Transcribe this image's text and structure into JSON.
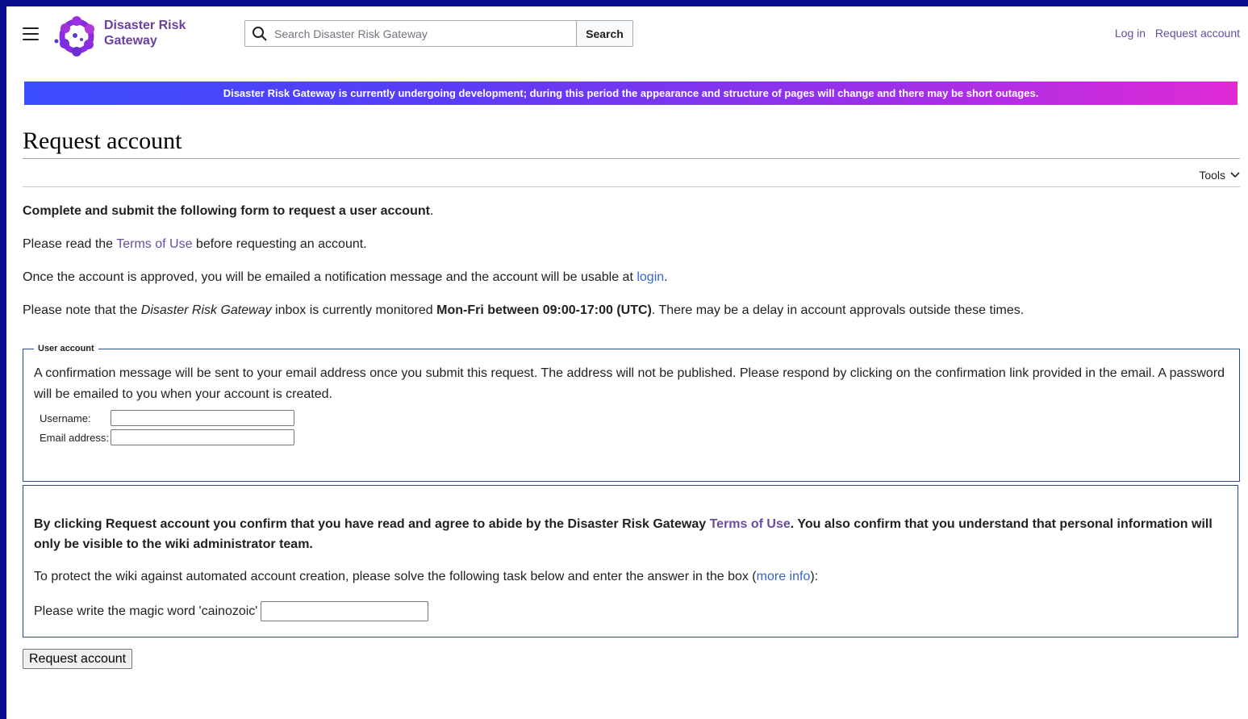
{
  "header": {
    "brand_line1": "Disaster Risk",
    "brand_line2": "Gateway",
    "search_placeholder": "Search Disaster Risk Gateway",
    "search_button": "Search",
    "login": "Log in",
    "request_account": "Request account"
  },
  "banner": {
    "text": "Disaster Risk Gateway is currently undergoing development; during this period the appearance and structure of pages will change and there may be short outages."
  },
  "page": {
    "title": "Request account",
    "tools": "Tools"
  },
  "intro": {
    "line1_bold": "Complete and submit the following form to request a user account",
    "line1_end": ".",
    "line2_pre": "Please read the ",
    "line2_link": "Terms of Use",
    "line2_post": " before requesting an account.",
    "line3_pre": "Once the account is approved, you will be emailed a notification message and the account will be usable at ",
    "line3_link": "login",
    "line3_post": ".",
    "line4_pre": "Please note that the ",
    "line4_italic": "Disaster Risk Gateway",
    "line4_mid": " inbox is currently monitored ",
    "line4_bold": "Mon-Fri between 09:00-17:00 (UTC)",
    "line4_post": ". There may be a delay in account approvals outside these times."
  },
  "user_account": {
    "legend": "User account",
    "text": "A confirmation message will be sent to your email address once you submit this request. The address will not be published. Please respond by clicking on the confirmation link provided in the email. A password will be emailed to you when your account is created.",
    "username_label": "Username:",
    "username_value": "",
    "email_label": "Email address:",
    "email_value": ""
  },
  "agreement": {
    "agree_pre": "By clicking Request account you confirm that you have read and agree to abide by the Disaster Risk Gateway ",
    "agree_link": "Terms of Use",
    "agree_post": ". You also confirm that you understand that personal information will only be visible to the wiki administrator team.",
    "protect_pre": "To protect the wiki against automated account creation, please solve the following task below and enter the answer in the box (",
    "protect_link": "more info",
    "protect_post": "):",
    "magic_label": "Please write the magic word 'cainozoic'",
    "magic_value": ""
  },
  "submit": {
    "label": "Request account"
  },
  "colors": {
    "brand": "#6b3fa0",
    "link": "#3366cc",
    "visited_link": "#6b4ba1",
    "frame": "#0b0f8f"
  }
}
